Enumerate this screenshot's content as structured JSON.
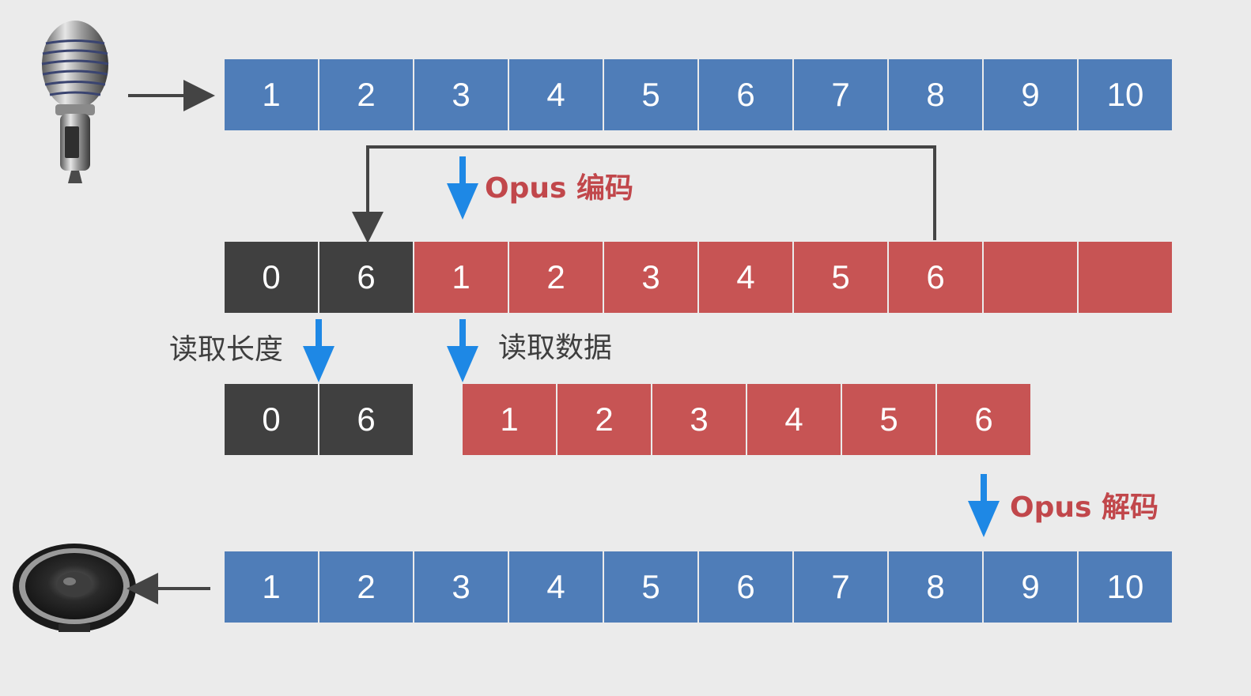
{
  "input_frames": [
    "1",
    "2",
    "3",
    "4",
    "5",
    "6",
    "7",
    "8",
    "9",
    "10"
  ],
  "encoded_header": [
    "0",
    "6"
  ],
  "encoded_frames": [
    "1",
    "2",
    "3",
    "4",
    "5",
    "6",
    "",
    ""
  ],
  "read_header": [
    "0",
    "6"
  ],
  "read_data": [
    "1",
    "2",
    "3",
    "4",
    "5",
    "6"
  ],
  "output_frames": [
    "1",
    "2",
    "3",
    "4",
    "5",
    "6",
    "7",
    "8",
    "9",
    "10"
  ],
  "labels": {
    "encode": "Opus 编码",
    "read_length": "读取长度",
    "read_data": "读取数据",
    "decode": "Opus 解码"
  },
  "icons": {
    "input": "microphone-icon",
    "output": "speaker-icon"
  },
  "colors": {
    "pcm_block": "#4f7db8",
    "encoded_block": "#c75454",
    "length_block": "#404040",
    "flow_arrow": "#1e88e5",
    "codec_label": "#c1474b",
    "background": "#ebebeb"
  }
}
